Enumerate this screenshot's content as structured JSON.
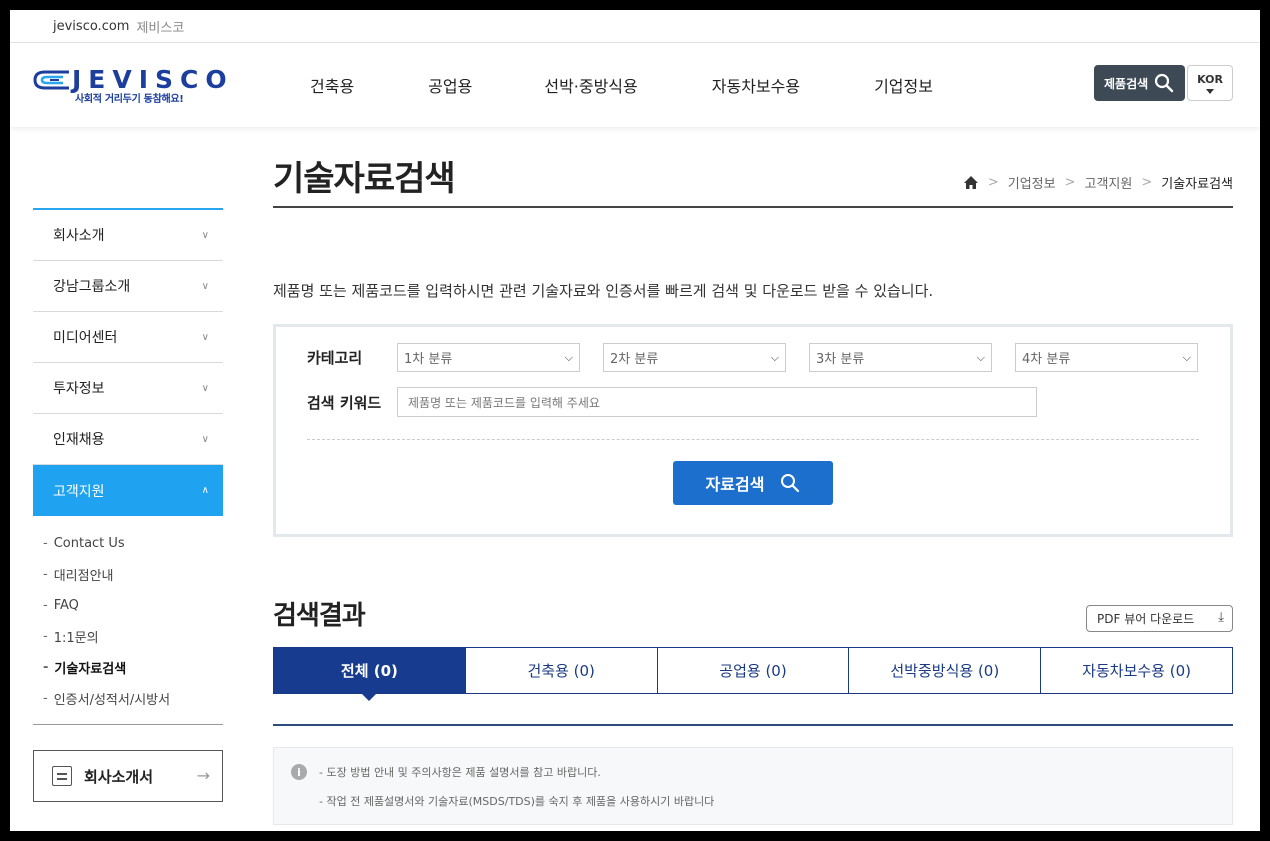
{
  "topbar": {
    "site": "jevisco.com",
    "site_kr": "제비스코"
  },
  "logo": {
    "word": "JEVISCO",
    "slogan": "사회적 거리두기 동참해요!"
  },
  "gnb": [
    "건축용",
    "공업용",
    "선박·중방식용",
    "자동차보수용",
    "기업정보"
  ],
  "header": {
    "product_search": "제품검색",
    "lang": "KOR"
  },
  "sidebar": {
    "items": [
      {
        "label": "회사소개"
      },
      {
        "label": "강남그룹소개"
      },
      {
        "label": "미디어센터"
      },
      {
        "label": "투자정보"
      },
      {
        "label": "인재채용"
      },
      {
        "label": "고객지원"
      }
    ],
    "sub": [
      "Contact Us",
      "대리점안내",
      "FAQ",
      "1:1문의",
      "기술자료검색",
      "인증서/성적서/시방서"
    ],
    "brochure": "회사소개서"
  },
  "page": {
    "title": "기술자료검색",
    "crumbs": [
      "기업정보",
      "고객지원",
      "기술자료검색"
    ],
    "intro": "제품명 또는 제품코드를 입력하시면 관련 기술자료와 인증서를 빠르게 검색 및 다운로드 받을 수 있습니다."
  },
  "search": {
    "category_label": "카테고리",
    "selects": [
      "1차 분류",
      "2차 분류",
      "3차 분류",
      "4차 분류"
    ],
    "keyword_label": "검색 키워드",
    "keyword_placeholder": "제품명 또는 제품코드를 입력해 주세요",
    "button": "자료검색"
  },
  "results": {
    "title": "검색결과",
    "pdf_button": "PDF 뷰어 다운로드",
    "tabs": [
      "전체 (0)",
      "건축용 (0)",
      "공업용 (0)",
      "선박중방식용 (0)",
      "자동차보수용 (0)"
    ]
  },
  "notice": [
    "-  도장 방법 안내 및 주의사항은 제품 설명서를 참고 바랍니다.",
    "-  작업 전 제품설명서와 기술자료(MSDS/TDS)를 숙지 후 제품을 사용하시기 바랍니다"
  ],
  "colors": {
    "brand": "#1c3f9e",
    "accent": "#1fa2f0",
    "tab_active": "#173b8f",
    "button": "#1d6fce"
  }
}
